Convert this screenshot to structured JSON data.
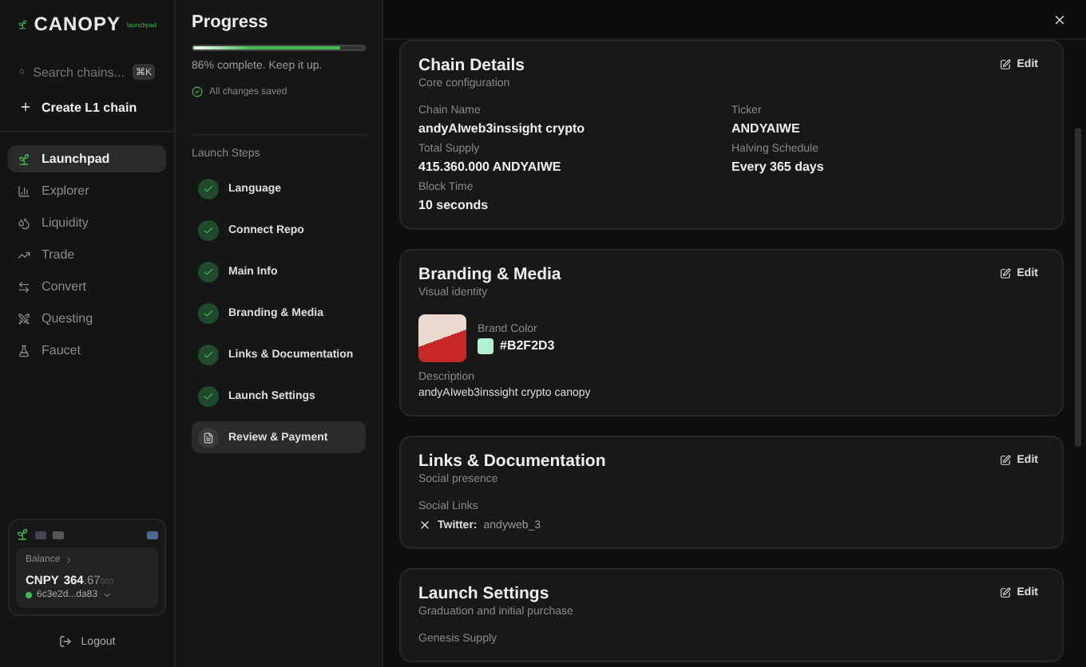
{
  "brand": {
    "name": "CANOPY",
    "tag": "launchpad"
  },
  "search": {
    "placeholder": "Search chains...",
    "shortcut": "⌘K"
  },
  "create_button": {
    "label": "Create L1 chain"
  },
  "nav": [
    {
      "label": "Launchpad",
      "selected": true
    },
    {
      "label": "Explorer",
      "selected": false
    },
    {
      "label": "Liquidity",
      "selected": false
    },
    {
      "label": "Trade",
      "selected": false
    },
    {
      "label": "Convert",
      "selected": false
    },
    {
      "label": "Questing",
      "selected": false
    },
    {
      "label": "Faucet",
      "selected": false
    }
  ],
  "wallet": {
    "balance_label": "Balance",
    "currency": "CNPY",
    "whole": "364",
    "fraction": ".67",
    "trailing": "000",
    "address": "6c3e2d...da83",
    "connected": true
  },
  "logout": {
    "label": "Logout"
  },
  "progress": {
    "title": "Progress",
    "level": 0.86,
    "caption": "86% complete. Keep it up.",
    "saved": "All changes saved"
  },
  "steps_title": "Launch Steps",
  "steps": [
    {
      "label": "Language",
      "kind": "done",
      "selected": false
    },
    {
      "label": "Connect Repo",
      "kind": "done",
      "selected": false
    },
    {
      "label": "Main Info",
      "kind": "done",
      "selected": false
    },
    {
      "label": "Branding & Media",
      "kind": "done",
      "selected": false
    },
    {
      "label": "Links & Documentation",
      "kind": "done",
      "selected": false
    },
    {
      "label": "Launch Settings",
      "kind": "done",
      "selected": false
    },
    {
      "label": "Review & Payment",
      "kind": "current",
      "selected": true
    }
  ],
  "cards": [
    {
      "kind": "fields",
      "title": "Chain Details",
      "subtitle": "Core configuration",
      "edit": "Edit",
      "fields": [
        {
          "label": "Chain Name",
          "value": "andyAIweb3inssight crypto"
        },
        {
          "label": "Ticker",
          "value": "ANDYAIWE"
        },
        {
          "label": "Total Supply",
          "value": "415.360.000 ANDYAIWE"
        },
        {
          "label": "Halving Schedule",
          "value": "Every 365 days"
        },
        {
          "label": "Block Time",
          "value": "10 seconds"
        }
      ]
    },
    {
      "kind": "branding",
      "title": "Branding & Media",
      "subtitle": "Visual identity",
      "edit": "Edit",
      "brand_color_label": "Brand Color",
      "brand_color": "#B2F2D3",
      "color": "#b2f2d3",
      "description_label": "Description",
      "description": "andyAIweb3inssight crypto canopy"
    },
    {
      "kind": "links",
      "title": "Links & Documentation",
      "subtitle": "Social presence",
      "edit": "Edit",
      "links_label": "Social Links",
      "links": [
        {
          "platform": "Twitter:",
          "handle": "andyweb_3"
        }
      ]
    },
    {
      "kind": "fields",
      "title": "Launch Settings",
      "subtitle": "Graduation and initial purchase",
      "edit": "Edit",
      "fields": [
        {
          "label": "Genesis Supply"
        }
      ]
    }
  ]
}
